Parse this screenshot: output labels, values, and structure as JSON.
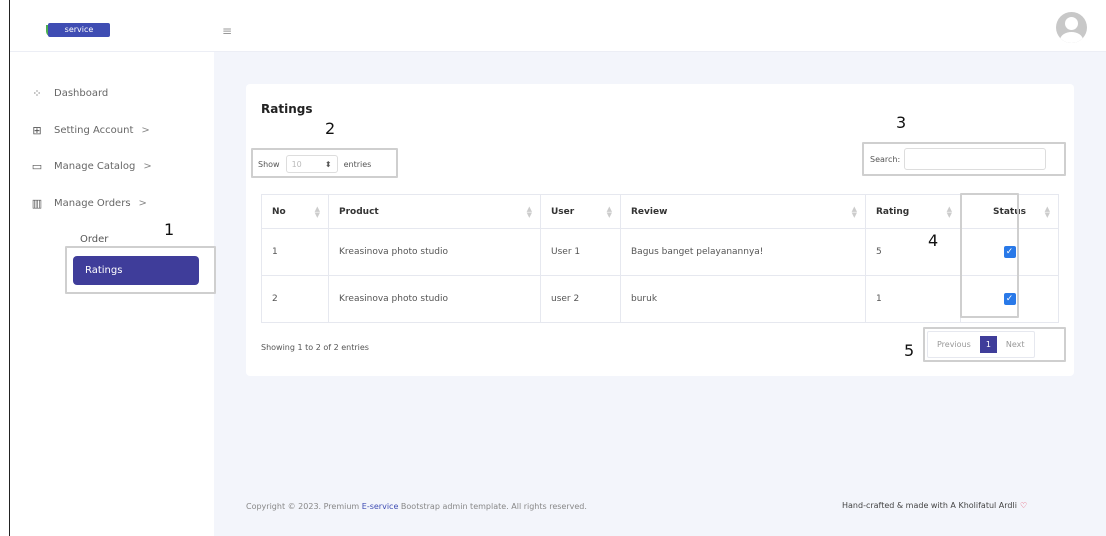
{
  "header": {
    "logo_text": "service",
    "menu_icon": "hamburger-icon",
    "avatar_icon": "user-avatar-icon"
  },
  "sidebar": {
    "items": [
      {
        "label": "Dashboard",
        "icon": "grid-icon",
        "has_chevron": false
      },
      {
        "label": "Setting Account",
        "icon": "layout-icon",
        "has_chevron": true
      },
      {
        "label": "Manage Catalog",
        "icon": "folder-icon",
        "has_chevron": true
      },
      {
        "label": "Manage Orders",
        "icon": "columns-icon",
        "has_chevron": true
      }
    ],
    "chevron": ">",
    "sub_items": {
      "order": "Order",
      "ratings": "Ratings"
    }
  },
  "card": {
    "title": "Ratings",
    "show_label": "Show",
    "entries_value": "10",
    "entries_label": "entries",
    "search_label": "Search:",
    "search_value": ""
  },
  "table": {
    "headers": [
      "No",
      "Product",
      "User",
      "Review",
      "Rating",
      "Status"
    ],
    "rows": [
      {
        "no": "1",
        "product": "Kreasinova photo studio",
        "user": "User 1",
        "review": "Bagus banget pelayanannya!",
        "rating": "5",
        "status_checked": true
      },
      {
        "no": "2",
        "product": "Kreasinova photo studio",
        "user": "user 2",
        "review": "buruk",
        "rating": "1",
        "status_checked": true
      }
    ]
  },
  "info": {
    "showing": "Showing 1 to 2 of 2 entries"
  },
  "pagination": {
    "previous": "Previous",
    "current": "1",
    "next": "Next"
  },
  "footer": {
    "copyright_prefix": "Copyright © 2023. Premium ",
    "brand": "E-service",
    "copyright_suffix": " Bootstrap admin template. All rights reserved.",
    "credit": "Hand-crafted & made with A Kholifatul Ardli"
  },
  "annotations": [
    "1",
    "2",
    "3",
    "4",
    "5"
  ],
  "colors": {
    "accent": "#3f3d9a",
    "checkbox": "#2979e8",
    "background": "#f3f5fb"
  }
}
